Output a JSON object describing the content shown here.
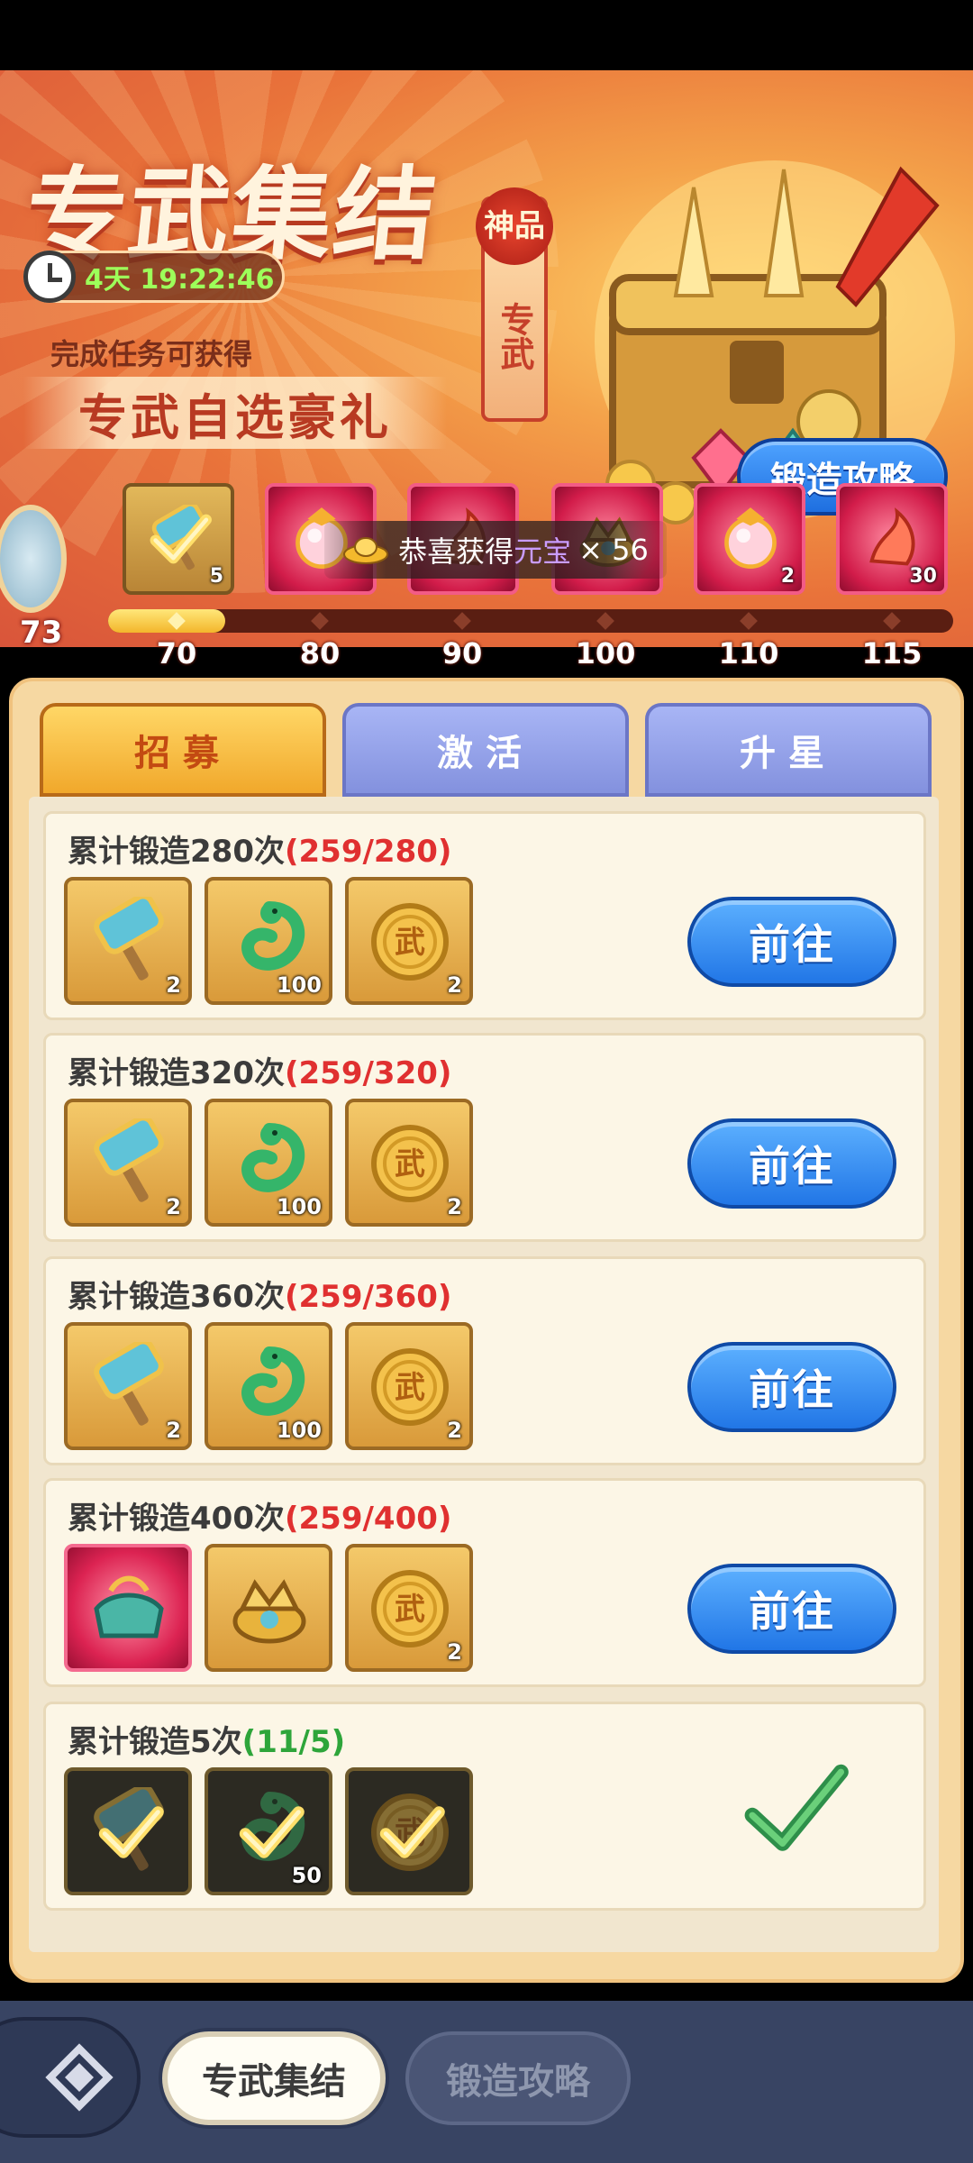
{
  "event": {
    "title": "专武集结",
    "timer": "4天 19:22:46",
    "subtitle": "完成任务可获得",
    "gift_name": "专武自选豪礼",
    "seal_top": "神品",
    "seal_text": "专武",
    "guide_button": "锻造攻略"
  },
  "milestones": {
    "player_level": "73",
    "progress_fraction": 0.075,
    "ticks": [
      "70",
      "80",
      "90",
      "100",
      "110",
      "115"
    ],
    "rewards": [
      {
        "kind": "gold",
        "icon": "hammer-claimed-icon",
        "count": "5"
      },
      {
        "kind": "red",
        "icon": "orb-icon",
        "count": ""
      },
      {
        "kind": "red",
        "icon": "flame-icon",
        "count": ""
      },
      {
        "kind": "red",
        "icon": "dragon-treasure-icon",
        "count": ""
      },
      {
        "kind": "red",
        "icon": "orb-icon",
        "count": "2"
      },
      {
        "kind": "red",
        "icon": "flame-blade-icon",
        "count": "30"
      }
    ]
  },
  "toast": {
    "prefix": "恭喜获得",
    "item": "元宝",
    "suffix": "× 56"
  },
  "tabs": [
    "招募",
    "激活",
    "升星"
  ],
  "tasks": [
    {
      "label": "累计锻造280次",
      "progress": "(259/280)",
      "done": false,
      "button": "前往",
      "items": [
        {
          "icon": "hammer-icon",
          "count": "2"
        },
        {
          "icon": "jade-dragon-icon",
          "count": "100"
        },
        {
          "icon": "wu-coin-icon",
          "count": "2"
        }
      ]
    },
    {
      "label": "累计锻造320次",
      "progress": "(259/320)",
      "done": false,
      "button": "前往",
      "items": [
        {
          "icon": "hammer-icon",
          "count": "2"
        },
        {
          "icon": "jade-dragon-icon",
          "count": "100"
        },
        {
          "icon": "wu-coin-icon",
          "count": "2"
        }
      ]
    },
    {
      "label": "累计锻造360次",
      "progress": "(259/360)",
      "done": false,
      "button": "前往",
      "items": [
        {
          "icon": "hammer-icon",
          "count": "2"
        },
        {
          "icon": "jade-dragon-icon",
          "count": "100"
        },
        {
          "icon": "wu-coin-icon",
          "count": "2"
        }
      ]
    },
    {
      "label": "累计锻造400次",
      "progress": "(259/400)",
      "done": false,
      "button": "前往",
      "items": [
        {
          "icon": "treasure-box-icon",
          "count": "",
          "kind": "red"
        },
        {
          "icon": "dragon-crown-icon",
          "count": ""
        },
        {
          "icon": "wu-coin-icon",
          "count": "2"
        }
      ]
    },
    {
      "label": "累计锻造5次",
      "progress": "(11/5)",
      "done": true,
      "button": "",
      "items": [
        {
          "icon": "hammer-icon",
          "count": ""
        },
        {
          "icon": "jade-dragon-icon",
          "count": "50"
        },
        {
          "icon": "wu-coin-icon",
          "count": ""
        }
      ]
    }
  ],
  "bottom_nav": {
    "active": "专武集结",
    "inactive": "锻造攻略"
  },
  "colors": {
    "progress_red": "#e03030",
    "progress_green": "#2ea53a",
    "button_blue": "#2176e6",
    "tab_active": "#f1a82b",
    "tab_inactive": "#8391de"
  }
}
